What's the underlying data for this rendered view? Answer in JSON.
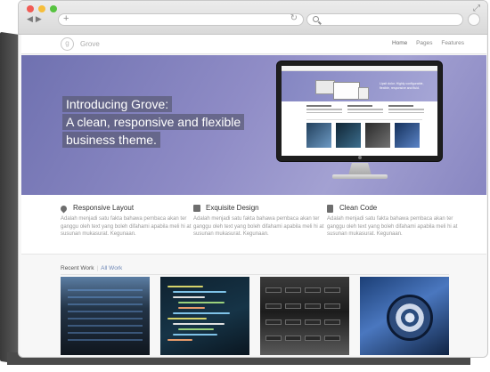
{
  "browser": {
    "address_value": "",
    "search_value": ""
  },
  "site": {
    "logo_letter": "g",
    "name": "Grove",
    "nav": [
      {
        "label": "Home",
        "active": true
      },
      {
        "label": "Pages",
        "active": false
      },
      {
        "label": "Features",
        "active": false
      }
    ]
  },
  "hero": {
    "lines": [
      "Introducing Grove:",
      "A clean, responsive and flexible",
      "business theme."
    ],
    "screen_caption": "Lipsit dolor. Highly configurable, flexible, responsive and fluid."
  },
  "features": [
    {
      "icon": "drops-icon",
      "title": "Responsive Layout",
      "body": "Adalah menjadi satu fakta bahawa pembaca akan ter ganggu oleh text yang boleh difahami apabila meli hi at susunan mukasurat. Kegunaan."
    },
    {
      "icon": "design-icon",
      "title": "Exquisite Design",
      "body": "Adalah menjadi satu fakta bahawa pembaca akan ter ganggu oleh text yang boleh difahami apabila meli hi at susunan mukasurat. Kegunaan."
    },
    {
      "icon": "document-icon",
      "title": "Clean Code",
      "body": "Adalah menjadi satu fakta bahawa pembaca akan ter ganggu oleh text yang boleh difahami apabila meli hi at susunan mukasurat. Kegunaan."
    }
  ],
  "recent_work": {
    "tab_recent": "Recent Work",
    "tab_all": "All Work",
    "items": [
      "server-rack-image",
      "code-editor-image",
      "hard-drive-image",
      "car-wheel-image"
    ]
  }
}
